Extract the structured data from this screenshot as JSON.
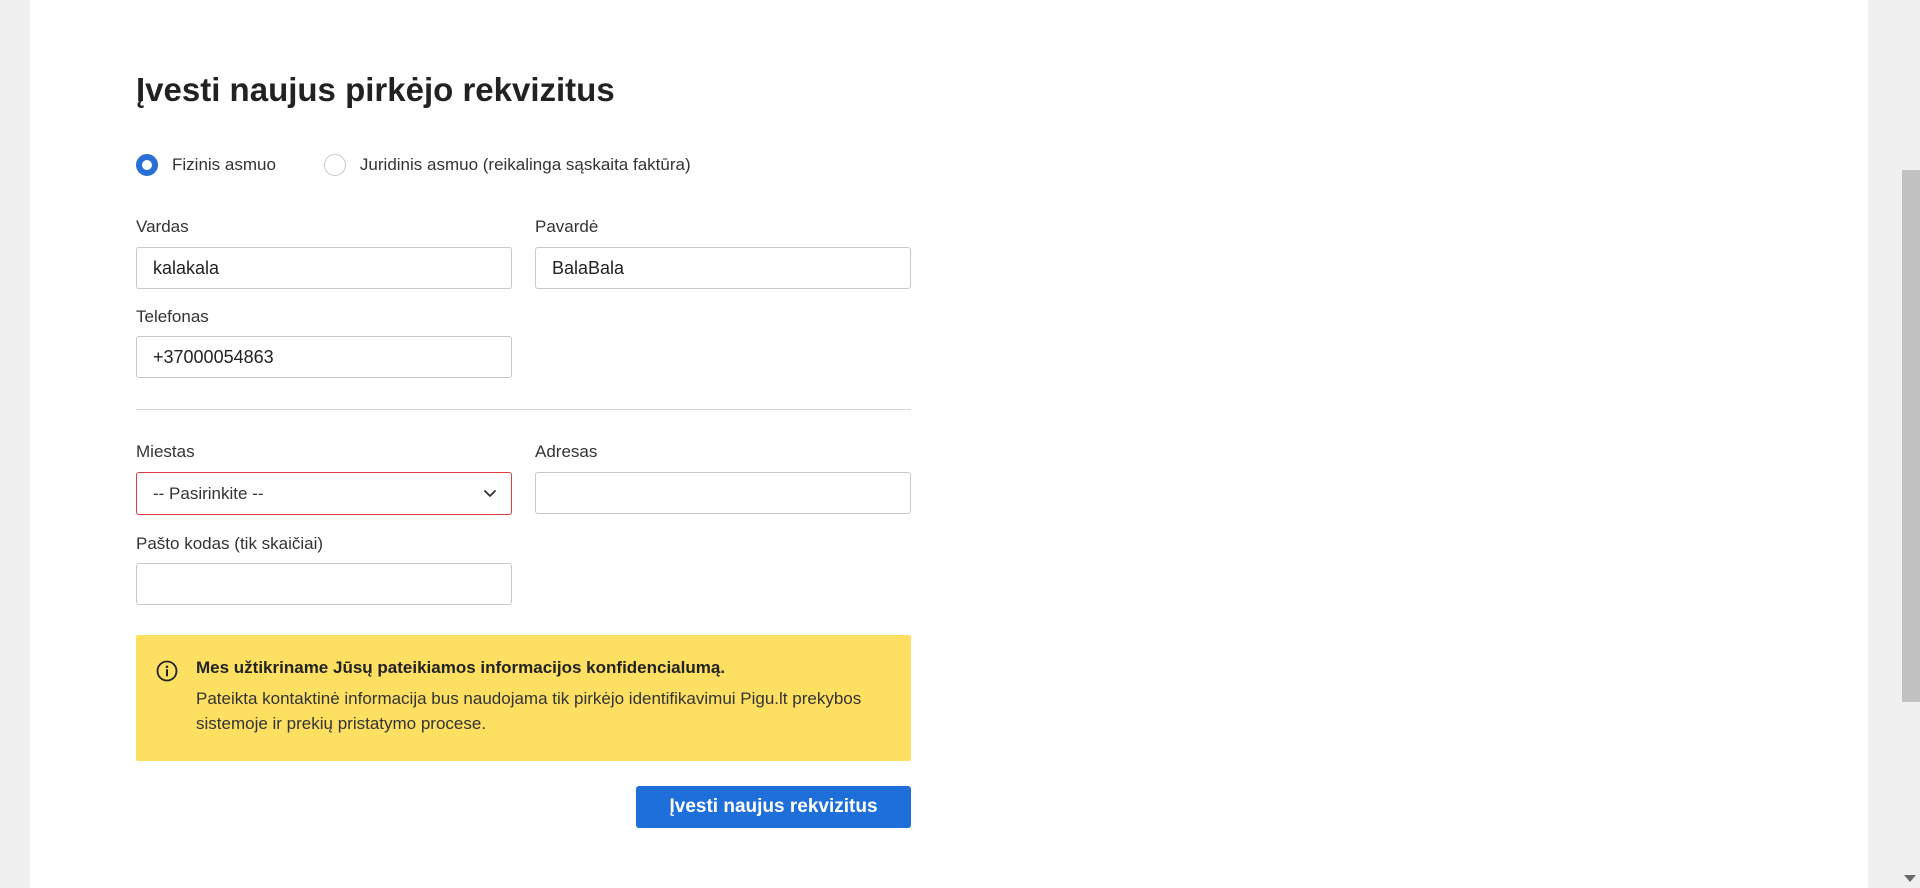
{
  "form": {
    "title": "Įvesti naujus pirkėjo rekvizitus",
    "buyer_type": {
      "options": [
        {
          "label": "Fizinis asmuo",
          "selected": true
        },
        {
          "label": "Juridinis asmuo (reikalinga sąskaita faktūra)",
          "selected": false
        }
      ]
    },
    "first_name": {
      "label": "Vardas",
      "value": "kalakala"
    },
    "last_name": {
      "label": "Pavardė",
      "value": "BalaBala"
    },
    "phone": {
      "label": "Telefonas",
      "value": "+37000054863"
    },
    "city": {
      "label": "Miestas",
      "selected": "-- Pasirinkite --",
      "state": "error"
    },
    "address": {
      "label": "Adresas",
      "value": ""
    },
    "postal_code": {
      "label": "Pašto kodas (tik skaičiai)",
      "value": ""
    },
    "notice": {
      "icon": "info-icon",
      "title": "Mes užtikriname Jūsų pateikiamos informacijos konfidencialumą.",
      "body": "Pateikta kontaktinė informacija bus naudojama tik pirkėjo identifikavimui Pigu.lt prekybos sistemoje ir prekių pristatymo procese."
    },
    "submit_label": "Įvesti naujus rekvizitus"
  },
  "colors": {
    "accent": "#1e6fd9",
    "notice_bg": "#fddf62",
    "error_border": "#e03b3b"
  }
}
